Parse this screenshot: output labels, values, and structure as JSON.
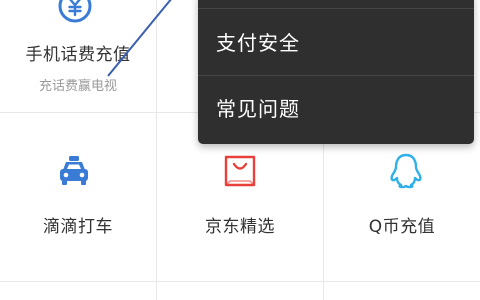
{
  "tiles": [
    {
      "title": "手机话费充值",
      "subtitle": "充话费赢电视",
      "icon": "yuan-coin-icon",
      "color": "#3a7bd5"
    },
    {
      "title": "滴滴打车",
      "icon": "taxi-icon",
      "color": "#3a7bd5"
    },
    {
      "title": "京东精选",
      "icon": "shopping-bag-icon",
      "color": "#e8413c"
    },
    {
      "title": "Q币充值",
      "icon": "qq-penguin-icon",
      "color": "#2fb0e8"
    }
  ],
  "popup_menu": {
    "items": [
      {
        "label": "支付安全"
      },
      {
        "label": "常见问题"
      }
    ]
  },
  "colors": {
    "popup_bg": "#2f2f2f",
    "annotation_line": "#3a5fb0"
  }
}
